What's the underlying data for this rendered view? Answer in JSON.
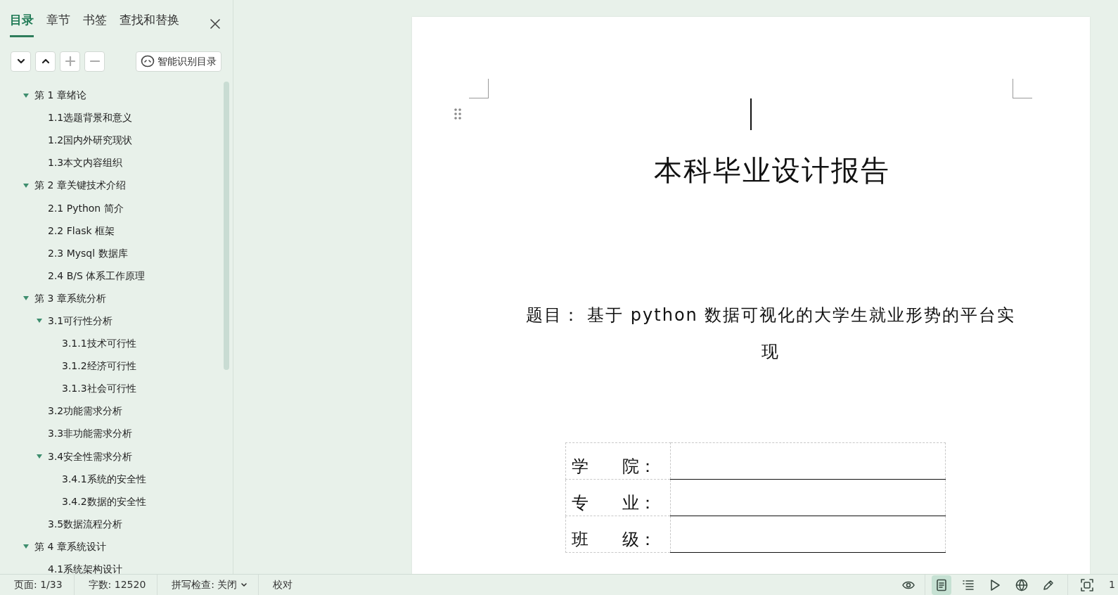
{
  "sidebar": {
    "tabs": [
      {
        "label": "目录",
        "selected": true
      },
      {
        "label": "章节",
        "selected": false
      },
      {
        "label": "书签",
        "selected": false
      },
      {
        "label": "查找和替换",
        "selected": false
      }
    ],
    "toolbar": [
      {
        "kind": "down",
        "disabled": false
      },
      {
        "kind": "up",
        "disabled": false
      },
      {
        "kind": "add",
        "disabled": true
      },
      {
        "kind": "remove",
        "disabled": true
      }
    ],
    "smart_button": "智能识别目录",
    "outline": [
      {
        "title": "第 1  章绪论",
        "expanded": true,
        "children": [
          {
            "title": "1.1选题背景和意义"
          },
          {
            "title": "1.2国内外研究现状"
          },
          {
            "title": "1.3本文内容组织"
          }
        ]
      },
      {
        "title": "第 2  章关键技术介绍",
        "expanded": true,
        "children": [
          {
            "title": "2.1  Python 简介"
          },
          {
            "title": "2.2  Flask 框架"
          },
          {
            "title": "2.3  Mysql 数据库"
          },
          {
            "title": "2.4  B/S 体系工作原理"
          }
        ]
      },
      {
        "title": "第 3  章系统分析",
        "expanded": true,
        "children": [
          {
            "title": "3.1可行性分析",
            "expanded": true,
            "children": [
              {
                "title": "3.1.1技术可行性"
              },
              {
                "title": "3.1.2经济可行性"
              },
              {
                "title": "3.1.3社会可行性"
              }
            ]
          },
          {
            "title": "3.2功能需求分析"
          },
          {
            "title": "3.3非功能需求分析"
          },
          {
            "title": "3.4安全性需求分析",
            "expanded": true,
            "children": [
              {
                "title": "3.4.1系统的安全性"
              },
              {
                "title": "3.4.2数据的安全性"
              }
            ]
          },
          {
            "title": "3.5数据流程分析"
          }
        ]
      },
      {
        "title": "第 4  章系统设计",
        "expanded": true,
        "children": [
          {
            "title": "4.1系统架构设计"
          }
        ]
      }
    ]
  },
  "document": {
    "title": "本科毕业设计报告",
    "topic": "题目：  基于 python 数据可视化的大学生就业形势的平台实现",
    "fields": [
      {
        "label": "学　　院："
      },
      {
        "label": "专　　业："
      },
      {
        "label": "班　　级："
      }
    ]
  },
  "status_bar": {
    "page": "页面: 1/33",
    "words": "字数: 12520",
    "spell_check": "拼写检查: 关闭",
    "proofread": "校对",
    "view_buttons": [
      {
        "kind": "eye",
        "selected": false
      },
      {
        "kind": "page",
        "selected": true
      },
      {
        "kind": "outline",
        "selected": false
      },
      {
        "kind": "play",
        "selected": false
      },
      {
        "kind": "globe",
        "selected": false
      },
      {
        "kind": "pen",
        "selected": false
      },
      {
        "kind": "fit",
        "selected": false
      }
    ],
    "zoom": "1"
  }
}
